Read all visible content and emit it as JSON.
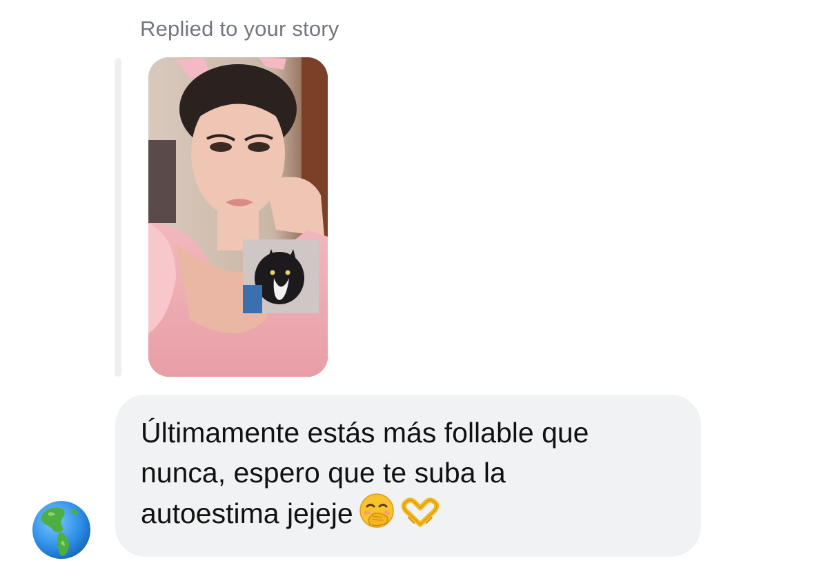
{
  "thread": {
    "reply_context": "Replied to your story"
  },
  "story": {
    "thumbnail": "story-photo"
  },
  "message": {
    "text": "Últimamente estás más follable que\nnunca, espero que te suba la\nautoestima jejeje",
    "emojis": [
      "face-with-hand-over-mouth-emoji",
      "heart-hands-emoji"
    ]
  },
  "sender": {
    "avatar": "globe-americas-icon"
  },
  "colors": {
    "bubble": "#f1f2f4",
    "meta_text": "#737680",
    "reply_bar": "#eeeff1"
  }
}
